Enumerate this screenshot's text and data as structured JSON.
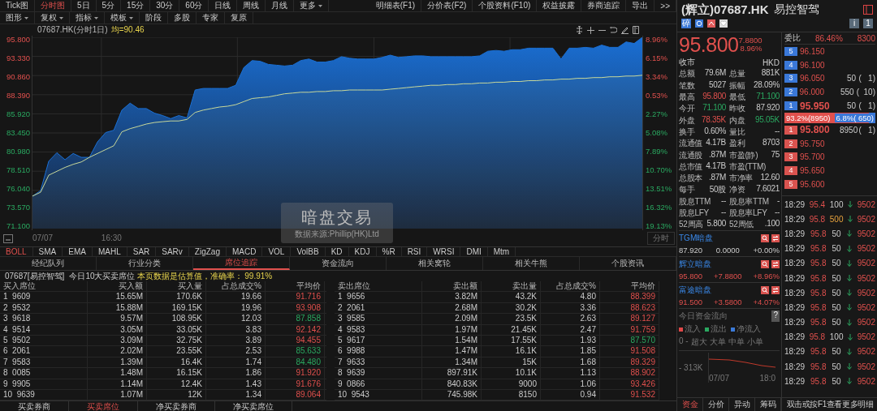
{
  "period_tabs": [
    {
      "label": "Tick图",
      "selected": false
    },
    {
      "label": "分时图",
      "selected": true
    },
    {
      "label": "5日",
      "selected": false
    },
    {
      "label": "5分",
      "selected": false
    },
    {
      "label": "15分",
      "selected": false
    },
    {
      "label": "30分",
      "selected": false
    },
    {
      "label": "60分",
      "selected": false
    },
    {
      "label": "日线",
      "selected": false
    },
    {
      "label": "周线",
      "selected": false
    },
    {
      "label": "月线",
      "selected": false
    },
    {
      "label": "更多",
      "selected": false,
      "kind": "dropdown"
    }
  ],
  "top_links": [
    "明细表(F1)",
    "分价表(F2)",
    "个股资料(F10)",
    "权益披露",
    "券商追踪",
    "导出",
    ">>"
  ],
  "toolbar": [
    {
      "label": "图形",
      "kind": "dropdown"
    },
    {
      "label": "复权",
      "kind": "dropdown"
    },
    {
      "label": "指标",
      "kind": "dropdown"
    },
    {
      "label": "模板",
      "kind": "dropdown"
    },
    {
      "label": "阶段",
      "kind": "plain"
    },
    {
      "label": "多股",
      "kind": "plain"
    },
    {
      "label": "专家",
      "kind": "plain"
    },
    {
      "label": "复原",
      "kind": "plain"
    }
  ],
  "chart": {
    "title": "07687.HK(分时1日)",
    "average": "均=90.46",
    "period_button": "分时",
    "overlay": {
      "title": "暗盘交易",
      "source": "数据来源:Phillip(HK)Ltd"
    },
    "x_labels": [
      "07/07",
      "16:30"
    ],
    "right_ticks": [
      {
        "label": "8.96%",
        "kind": "up"
      },
      {
        "label": "6.15%",
        "kind": "up"
      },
      {
        "label": "3.34%",
        "kind": "up"
      },
      {
        "label": "0.53%",
        "kind": "up"
      },
      {
        "label": "2.27%",
        "kind": "down"
      },
      {
        "label": "5.08%",
        "kind": "down"
      },
      {
        "label": "7.89%",
        "kind": "down"
      },
      {
        "label": "10.70%",
        "kind": "down"
      },
      {
        "label": "13.51%",
        "kind": "down"
      },
      {
        "label": "16.32%",
        "kind": "down"
      },
      {
        "label": "19.13%",
        "kind": "down"
      }
    ],
    "chart_data": {
      "type": "area",
      "grid": true,
      "ylim": [
        71.1,
        95.8
      ],
      "yticks": [
        {
          "value": 95.8,
          "label": "95.800"
        },
        {
          "value": 93.33,
          "label": "93.330"
        },
        {
          "value": 90.86,
          "label": "90.860"
        },
        {
          "value": 88.39,
          "label": "88.390"
        },
        {
          "value": 85.92,
          "label": "85.920"
        },
        {
          "value": 83.45,
          "label": "83.450"
        },
        {
          "value": 80.98,
          "label": "80.980"
        },
        {
          "value": 78.51,
          "label": "78.510"
        },
        {
          "value": 76.04,
          "label": "76.040"
        },
        {
          "value": 73.57,
          "label": "73.570"
        },
        {
          "value": 71.1,
          "label": "71.100"
        }
      ],
      "series": [
        {
          "color": "#1a6fd4",
          "values": [
            75.3,
            76.0,
            79.8,
            80.9,
            80.0,
            80.8,
            80.3,
            80.3,
            82.3,
            83.5,
            83.8,
            86.4,
            87.3,
            86.6,
            86.6,
            86.0,
            85.7,
            85.3,
            85.7,
            85.4,
            89.0,
            89.2,
            89.2,
            89.2,
            89.2,
            89.6,
            91.9,
            92.8,
            92.7,
            92.3,
            92.2,
            92.1,
            92.2,
            92.8,
            93.0,
            92.6,
            92.6,
            92.8,
            93.3,
            93.1,
            93.0,
            93.0,
            93.0,
            93.2,
            93.5,
            93.2,
            93.3,
            93.4,
            93.4,
            93.3,
            93.3,
            93.3,
            93.3,
            93.3,
            93.3,
            93.4,
            94.0,
            94.1,
            94.0,
            94.2,
            94.2,
            94.4,
            94.4,
            94.4,
            94.4,
            93.0,
            94.4,
            94.4,
            94.5,
            94.4,
            94.8,
            94.5,
            94.5,
            95.2,
            95.0,
            95.8
          ]
        },
        {
          "color": "#c8d89a",
          "values": [
            75.3,
            75.8,
            78.0,
            78.5,
            79.0,
            79.4,
            79.7,
            80.3,
            80.8,
            81.3,
            81.8,
            83.6,
            84.0,
            84.3,
            84.6,
            84.8,
            84.9,
            85.0,
            85.0,
            85.2,
            86.1,
            86.4,
            86.6,
            86.8,
            86.9,
            87.1,
            87.5,
            87.9,
            88.0,
            88.1,
            88.3,
            88.5,
            88.6,
            88.7,
            88.7,
            88.8,
            88.8,
            88.9,
            88.9,
            89.0,
            89.0,
            89.0,
            89.0,
            89.0,
            89.1,
            89.2,
            89.3,
            89.4,
            89.5,
            89.6,
            89.6,
            89.7,
            89.7,
            89.8,
            89.8,
            89.9,
            89.9,
            90.0,
            90.0,
            90.1,
            90.1,
            90.2,
            90.2,
            90.3,
            90.3,
            90.4,
            90.4,
            90.5,
            90.5,
            90.6,
            90.6,
            90.7,
            90.7,
            90.8,
            90.8,
            90.9
          ]
        }
      ]
    }
  },
  "indicators": [
    {
      "label": "BOLL",
      "selected": true
    },
    {
      "label": "SMA",
      "selected": false
    },
    {
      "label": "EMA",
      "selected": false
    },
    {
      "label": "MAHL",
      "selected": false
    },
    {
      "label": "SAR",
      "selected": false
    },
    {
      "label": "SARv",
      "selected": false
    },
    {
      "label": "ZigZag",
      "selected": false
    },
    {
      "label": "MACD",
      "selected": false
    },
    {
      "label": "VOL",
      "selected": false
    },
    {
      "label": "VolBB",
      "selected": false
    },
    {
      "label": "KD",
      "selected": false
    },
    {
      "label": "KDJ",
      "selected": false
    },
    {
      "label": "%R",
      "selected": false
    },
    {
      "label": "RSI",
      "selected": false
    },
    {
      "label": "WRSI",
      "selected": false
    },
    {
      "label": "DMI",
      "selected": false
    },
    {
      "label": "Mtm",
      "selected": false
    }
  ],
  "section_tabs": [
    {
      "label": "经纪队列",
      "selected": false
    },
    {
      "label": "行业分类",
      "selected": false
    },
    {
      "label": "席位追踪",
      "selected": true
    },
    {
      "label": "资金流向",
      "selected": false
    },
    {
      "label": "相关窝轮",
      "selected": false
    },
    {
      "label": "相关牛熊",
      "selected": false
    },
    {
      "label": "个股资讯",
      "selected": false
    }
  ],
  "info": {
    "stock": "07687[易控智驾]",
    "title": "今日10大买卖席位",
    "note": "本页数据是估算值，准确率： 99.91%"
  },
  "buy_table": {
    "columns": [
      "买入席位",
      "买入额",
      "买入量",
      "占总成交%",
      "平均价"
    ],
    "rows": [
      {
        "rank": "1",
        "seat": "9609",
        "amount": "15.65M",
        "volume": "170.6K",
        "share": "19.66",
        "avg": "91.716",
        "kind": "up"
      },
      {
        "rank": "2",
        "seat": "9532",
        "amount": "15.88M",
        "volume": "169.15K",
        "share": "19.96",
        "avg": "93.908",
        "kind": "up"
      },
      {
        "rank": "3",
        "seat": "9618",
        "amount": "9.57M",
        "volume": "108.95K",
        "share": "12.03",
        "avg": "87.858",
        "kind": "down"
      },
      {
        "rank": "4",
        "seat": "9514",
        "amount": "3.05M",
        "volume": "33.05K",
        "share": "3.83",
        "avg": "92.142",
        "kind": "up"
      },
      {
        "rank": "5",
        "seat": "9502",
        "amount": "3.09M",
        "volume": "32.75K",
        "share": "3.89",
        "avg": "94.455",
        "kind": "up"
      },
      {
        "rank": "6",
        "seat": "2061",
        "amount": "2.02M",
        "volume": "23.55K",
        "share": "2.53",
        "avg": "85.633",
        "kind": "down"
      },
      {
        "rank": "7",
        "seat": "9583",
        "amount": "1.39M",
        "volume": "16.4K",
        "share": "1.74",
        "avg": "84.480",
        "kind": "down"
      },
      {
        "rank": "8",
        "seat": "0085",
        "amount": "1.48M",
        "volume": "16.15K",
        "share": "1.86",
        "avg": "91.920",
        "kind": "up"
      },
      {
        "rank": "9",
        "seat": "9905",
        "amount": "1.14M",
        "volume": "12.4K",
        "share": "1.43",
        "avg": "91.676",
        "kind": "up"
      },
      {
        "rank": "10",
        "seat": "9639",
        "amount": "1.07M",
        "volume": "12K",
        "share": "1.34",
        "avg": "89.064",
        "kind": "up"
      }
    ]
  },
  "sell_table": {
    "columns": [
      "卖出席位",
      "卖出额",
      "卖出量",
      "占总成交%",
      "平均价"
    ],
    "rows": [
      {
        "rank": "1",
        "seat": "9656",
        "amount": "3.82M",
        "volume": "43.2K",
        "share": "4.80",
        "avg": "88.399",
        "kind": "up"
      },
      {
        "rank": "2",
        "seat": "2061",
        "amount": "2.68M",
        "volume": "30.2K",
        "share": "3.36",
        "avg": "88.623",
        "kind": "up"
      },
      {
        "rank": "3",
        "seat": "9585",
        "amount": "2.09M",
        "volume": "23.5K",
        "share": "2.63",
        "avg": "89.127",
        "kind": "up"
      },
      {
        "rank": "4",
        "seat": "9583",
        "amount": "1.97M",
        "volume": "21.45K",
        "share": "2.47",
        "avg": "91.759",
        "kind": "up"
      },
      {
        "rank": "5",
        "seat": "9617",
        "amount": "1.54M",
        "volume": "17.55K",
        "share": "1.93",
        "avg": "87.570",
        "kind": "down"
      },
      {
        "rank": "6",
        "seat": "9988",
        "amount": "1.47M",
        "volume": "16.1K",
        "share": "1.85",
        "avg": "91.508",
        "kind": "up"
      },
      {
        "rank": "7",
        "seat": "9633",
        "amount": "1.34M",
        "volume": "15K",
        "share": "1.68",
        "avg": "89.329",
        "kind": "up"
      },
      {
        "rank": "8",
        "seat": "9639",
        "amount": "897.91K",
        "volume": "10.1K",
        "share": "1.13",
        "avg": "88.902",
        "kind": "up"
      },
      {
        "rank": "9",
        "seat": "0866",
        "amount": "840.83K",
        "volume": "9000",
        "share": "1.06",
        "avg": "93.426",
        "kind": "up"
      },
      {
        "rank": "10",
        "seat": "9543",
        "amount": "745.98K",
        "volume": "8150",
        "share": "0.94",
        "avg": "91.532",
        "kind": "up"
      }
    ]
  },
  "bottom_tabs": [
    {
      "label": "买卖券商",
      "selected": false
    },
    {
      "label": "买卖席位",
      "selected": true
    },
    {
      "label": "净买卖券商",
      "selected": false
    },
    {
      "label": "净买卖席位",
      "selected": false
    }
  ],
  "quote": {
    "name": "(辉立)07687.HK",
    "cn_name": "易控智驾",
    "badge": "碎",
    "info_badges": [
      "i",
      "1"
    ],
    "price": "95.800",
    "change": "7.8800",
    "change_pct": "8.96%",
    "status": "收市",
    "currency": "HKD",
    "stats": [
      [
        {
          "label": "总额",
          "value": "79.6M",
          "kind": "flat"
        },
        {
          "label": "总量",
          "value": "881K",
          "kind": "flat"
        }
      ],
      [
        {
          "label": "笔数",
          "value": "5027",
          "kind": "flat"
        },
        {
          "label": "振幅",
          "value": "28.09%",
          "kind": "flat"
        }
      ],
      [
        {
          "label": "最高",
          "value": "95.800",
          "kind": "up"
        },
        {
          "label": "最低",
          "value": "71.100",
          "kind": "down"
        }
      ],
      [
        {
          "label": "今开",
          "value": "71.100",
          "kind": "down"
        },
        {
          "label": "昨收",
          "value": "87.920",
          "kind": "flat"
        }
      ],
      [
        {
          "label": "外盘",
          "value": "78.35K",
          "kind": "up"
        },
        {
          "label": "内盘",
          "value": "95.05K",
          "kind": "down"
        }
      ],
      [
        {
          "label": "换手",
          "value": "0.60%",
          "kind": "flat"
        },
        {
          "label": "量比",
          "value": "--",
          "kind": "flat"
        }
      ],
      [
        {
          "label": "流通值",
          "value": "4.17B",
          "kind": "flat"
        },
        {
          "label": "盈利",
          "value": "8703",
          "kind": "flat"
        }
      ],
      [
        {
          "label": "流通股",
          "value": ".87M",
          "kind": "flat"
        },
        {
          "label": "市盈(静)",
          "value": "75",
          "kind": "flat"
        }
      ],
      [
        {
          "label": "总市值",
          "value": "4.17B",
          "kind": "flat"
        },
        {
          "label": "市盈(TTM)"
        }
      ],
      [
        {
          "label": "总股本",
          "value": ".87M",
          "kind": "flat"
        },
        {
          "label": "市净率",
          "value": "12.60",
          "kind": "flat"
        }
      ],
      [
        {
          "label": "每手",
          "value": "50股",
          "kind": "flat"
        },
        {
          "label": "净资",
          "value": "7.6021",
          "kind": "flat"
        }
      ],
      [
        {
          "label": "股息TTM",
          "value": "--",
          "kind": "flat"
        },
        {
          "label": "股息率TTM",
          "value": "-",
          "kind": "flat"
        }
      ],
      [
        {
          "label": "股息LFY",
          "value": "--",
          "kind": "flat"
        },
        {
          "label": "股息率LFY",
          "value": "--",
          "kind": "flat"
        }
      ],
      [
        {
          "label": "52周高",
          "value": "5.800",
          "kind": "flat"
        },
        {
          "label": "52周低",
          "value": ".100",
          "kind": "flat"
        }
      ]
    ],
    "dark_pools": [
      {
        "name": "TGM暗盘",
        "price": "87.920",
        "change": "0.0000",
        "change_pct": "+0.00%",
        "kind": "flat"
      },
      {
        "name": "辉立暗盘",
        "price": "95.800",
        "change": "+7.8800",
        "change_pct": "+8.96%",
        "kind": "up"
      },
      {
        "name": "富途暗盘",
        "price": "91.500",
        "change": "+3.5800",
        "change_pct": "+4.07%",
        "kind": "up"
      }
    ],
    "flow": {
      "title": "今日资金流向",
      "help": "?",
      "legend": [
        {
          "label": "流入",
          "color": "#e04848"
        },
        {
          "label": "流出",
          "color": "#2aa860"
        },
        {
          "label": "净流入",
          "color": "#3b7ad8"
        }
      ],
      "zero": "0 -",
      "categories": [
        "超大",
        "大单",
        "中单",
        "小单"
      ],
      "mini_value": "- 313K",
      "mini_x": [
        "07/07",
        "18:0"
      ]
    },
    "side_tabs": [
      {
        "label": "资金",
        "selected": true
      },
      {
        "label": "分价",
        "selected": false
      },
      {
        "label": "异动",
        "selected": false
      },
      {
        "label": "筹码",
        "selected": false
      }
    ]
  },
  "order_book": {
    "ratio_label": "委比",
    "ratio": "86.46%",
    "ratio_volume": "8300",
    "asks": [
      {
        "level": "5",
        "price": "96.150"
      },
      {
        "level": "4",
        "price": "96.100"
      },
      {
        "level": "3",
        "price": "96.050",
        "volume": "50",
        "orders": "(   1)"
      },
      {
        "level": "2",
        "price": "96.000",
        "volume": "550",
        "orders": "(  10)"
      },
      {
        "level": "1",
        "price": "95.950",
        "volume": "50",
        "orders": "(   1)"
      }
    ],
    "balance": {
      "buy_text": "93.2%(8950)",
      "sell_text": "6.8%( 650)",
      "level": 0.932
    },
    "bids": [
      {
        "level": "1",
        "price": "95.800",
        "volume": "8950",
        "orders": "(   1)"
      },
      {
        "level": "2",
        "price": "95.750"
      },
      {
        "level": "3",
        "price": "95.700"
      },
      {
        "level": "4",
        "price": "95.650"
      },
      {
        "level": "5",
        "price": "95.600"
      }
    ]
  },
  "ticks": [
    {
      "time": "18:29",
      "price": "95.4",
      "volume": "100",
      "big": false,
      "broker": "9502"
    },
    {
      "time": "18:29",
      "price": "95.8",
      "volume": "500",
      "big": true,
      "broker": "9502"
    },
    {
      "time": "18:29",
      "price": "95.8",
      "volume": "50",
      "big": false,
      "broker": "9502"
    },
    {
      "time": "18:29",
      "price": "95.8",
      "volume": "50",
      "big": false,
      "broker": "9502"
    },
    {
      "time": "18:29",
      "price": "95.8",
      "volume": "50",
      "big": false,
      "broker": "9502"
    },
    {
      "time": "18:29",
      "price": "95.8",
      "volume": "50",
      "big": false,
      "broker": "9502"
    },
    {
      "time": "18:29",
      "price": "95.8",
      "volume": "50",
      "big": false,
      "broker": "9502"
    },
    {
      "time": "18:29",
      "price": "95.8",
      "volume": "50",
      "big": false,
      "broker": "9502"
    },
    {
      "time": "18:29",
      "price": "95.8",
      "volume": "50",
      "big": false,
      "broker": "9502"
    },
    {
      "time": "18:29",
      "price": "95.8",
      "volume": "100",
      "big": false,
      "broker": "9502"
    },
    {
      "time": "18:29",
      "price": "95.8",
      "volume": "50",
      "big": false,
      "broker": "9502"
    },
    {
      "time": "18:29",
      "price": "95.8",
      "volume": "50",
      "big": false,
      "broker": "9502"
    },
    {
      "time": "18:29",
      "price": "95.8",
      "volume": "50",
      "big": false,
      "broker": "9502"
    }
  ],
  "ticks_hint": "双击或按F1查看更多明细"
}
